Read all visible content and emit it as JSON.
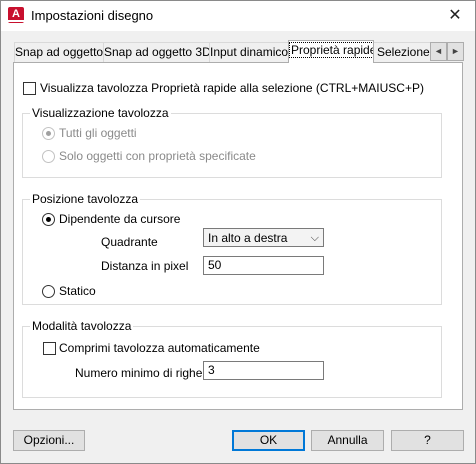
{
  "window": {
    "title": "Impostazioni disegno",
    "close_glyph": "✕",
    "app_icon_letter": "A"
  },
  "tabs": [
    {
      "label": "Snap ad oggetto"
    },
    {
      "label": "Snap ad oggetto 3D"
    },
    {
      "label": "Input dinamico"
    },
    {
      "label": "Proprietà rapide",
      "active": true
    },
    {
      "label": "Selezione c"
    }
  ],
  "tab_scroll": {
    "left": "◄",
    "right": "►"
  },
  "main": {
    "show_palette": {
      "label": "Visualizza tavolozza Proprietà rapide alla selezione (CTRL+MAIUSC+P)",
      "checked": false
    },
    "palette_display": {
      "legend": "Visualizzazione tavolozza",
      "all_objects": {
        "label": "Tutti gli oggetti",
        "selected": true,
        "disabled": true
      },
      "specified_only": {
        "label": "Solo oggetti con proprietà specificate",
        "selected": false,
        "disabled": true
      }
    },
    "palette_location": {
      "legend": "Posizione tavolozza",
      "cursor_dependent": {
        "label": "Dipendente da cursore",
        "selected": true
      },
      "quadrant": {
        "label": "Quadrante",
        "value": "In alto a destra"
      },
      "distance": {
        "label": "Distanza in pixel",
        "value": "50"
      },
      "static": {
        "label": "Statico",
        "selected": false
      }
    },
    "palette_behavior": {
      "legend": "Modalità tavolozza",
      "auto_collapse": {
        "label": "Comprimi tavolozza automaticamente",
        "checked": false
      },
      "min_rows": {
        "label": "Numero minimo di righe",
        "value": "3"
      }
    }
  },
  "buttons": {
    "options": "Opzioni...",
    "ok": "OK",
    "cancel": "Annulla",
    "help": "?"
  }
}
